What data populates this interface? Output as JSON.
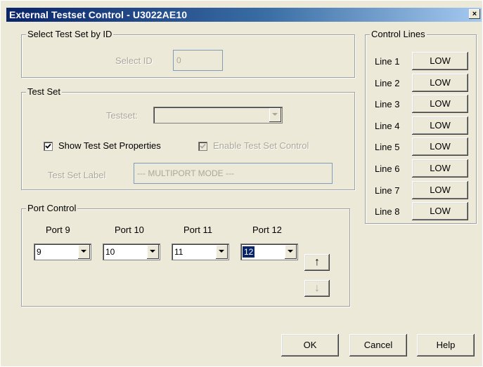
{
  "window": {
    "title": "External Testset Control - U3022AE10",
    "close_glyph": "×"
  },
  "select_by_id": {
    "group_label": "Select Test Set by ID",
    "field_label": "Select ID",
    "value": "0"
  },
  "test_set": {
    "group_label": "Test Set",
    "testset_label": "Testset:",
    "testset_value": "",
    "show_properties_label": "Show Test Set Properties",
    "show_properties_checked": true,
    "enable_control_label": "Enable Test Set Control",
    "enable_control_checked": true,
    "label_field_label": "Test Set Label",
    "label_value": "--- MULTIPORT MODE ---"
  },
  "control_lines": {
    "group_label": "Control Lines",
    "lines": [
      {
        "label": "Line 1",
        "state": "LOW"
      },
      {
        "label": "Line 2",
        "state": "LOW"
      },
      {
        "label": "Line 3",
        "state": "LOW"
      },
      {
        "label": "Line 4",
        "state": "LOW"
      },
      {
        "label": "Line 5",
        "state": "LOW"
      },
      {
        "label": "Line 6",
        "state": "LOW"
      },
      {
        "label": "Line 7",
        "state": "LOW"
      },
      {
        "label": "Line 8",
        "state": "LOW"
      }
    ]
  },
  "port_control": {
    "group_label": "Port Control",
    "ports": [
      {
        "label": "Port 9",
        "value": "9"
      },
      {
        "label": "Port 10",
        "value": "10"
      },
      {
        "label": "Port 11",
        "value": "11"
      },
      {
        "label": "Port 12",
        "value": "12",
        "selected": true
      }
    ],
    "up_glyph": "↑",
    "down_glyph": "↓"
  },
  "buttons": {
    "ok": "OK",
    "cancel": "Cancel",
    "help": "Help"
  }
}
